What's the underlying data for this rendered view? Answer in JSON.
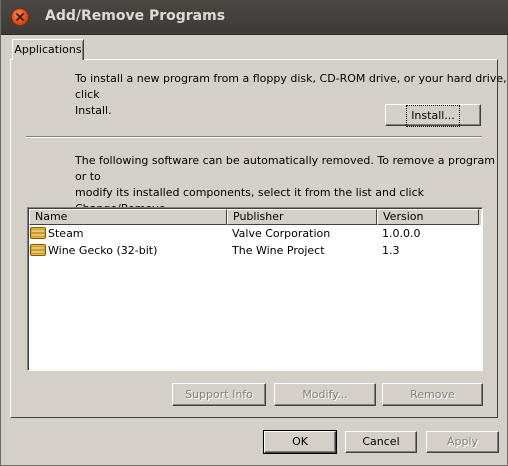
{
  "window": {
    "title": "Add/Remove Programs"
  },
  "tabs": [
    {
      "label": "Applications"
    }
  ],
  "install_section": {
    "line1": "To install a new program from a floppy disk, CD-ROM drive, or your hard drive, click",
    "line2": "Install.",
    "install_button": "Install..."
  },
  "remove_section": {
    "line1": "The following software can be automatically removed. To remove a program or to",
    "line2": "modify its installed components, select it from the list and click Change/Remove."
  },
  "list": {
    "columns": [
      "Name",
      "Publisher",
      "Version"
    ],
    "rows": [
      {
        "name": "Steam",
        "publisher": "Valve Corporation",
        "version": "1.0.0.0",
        "icon": "package-icon"
      },
      {
        "name": "Wine Gecko (32-bit)",
        "publisher": "The Wine Project",
        "version": "1.3",
        "icon": "package-icon"
      }
    ]
  },
  "actions": {
    "support_info": "Support Info",
    "modify": "Modify...",
    "remove": "Remove"
  },
  "dialog_buttons": {
    "ok": "OK",
    "cancel": "Cancel",
    "apply": "Apply"
  },
  "colors": {
    "face": "#d4d0c8",
    "titlebar": "#3c3b37",
    "close": "#df4a16",
    "title_text": "#dfdbd2"
  }
}
